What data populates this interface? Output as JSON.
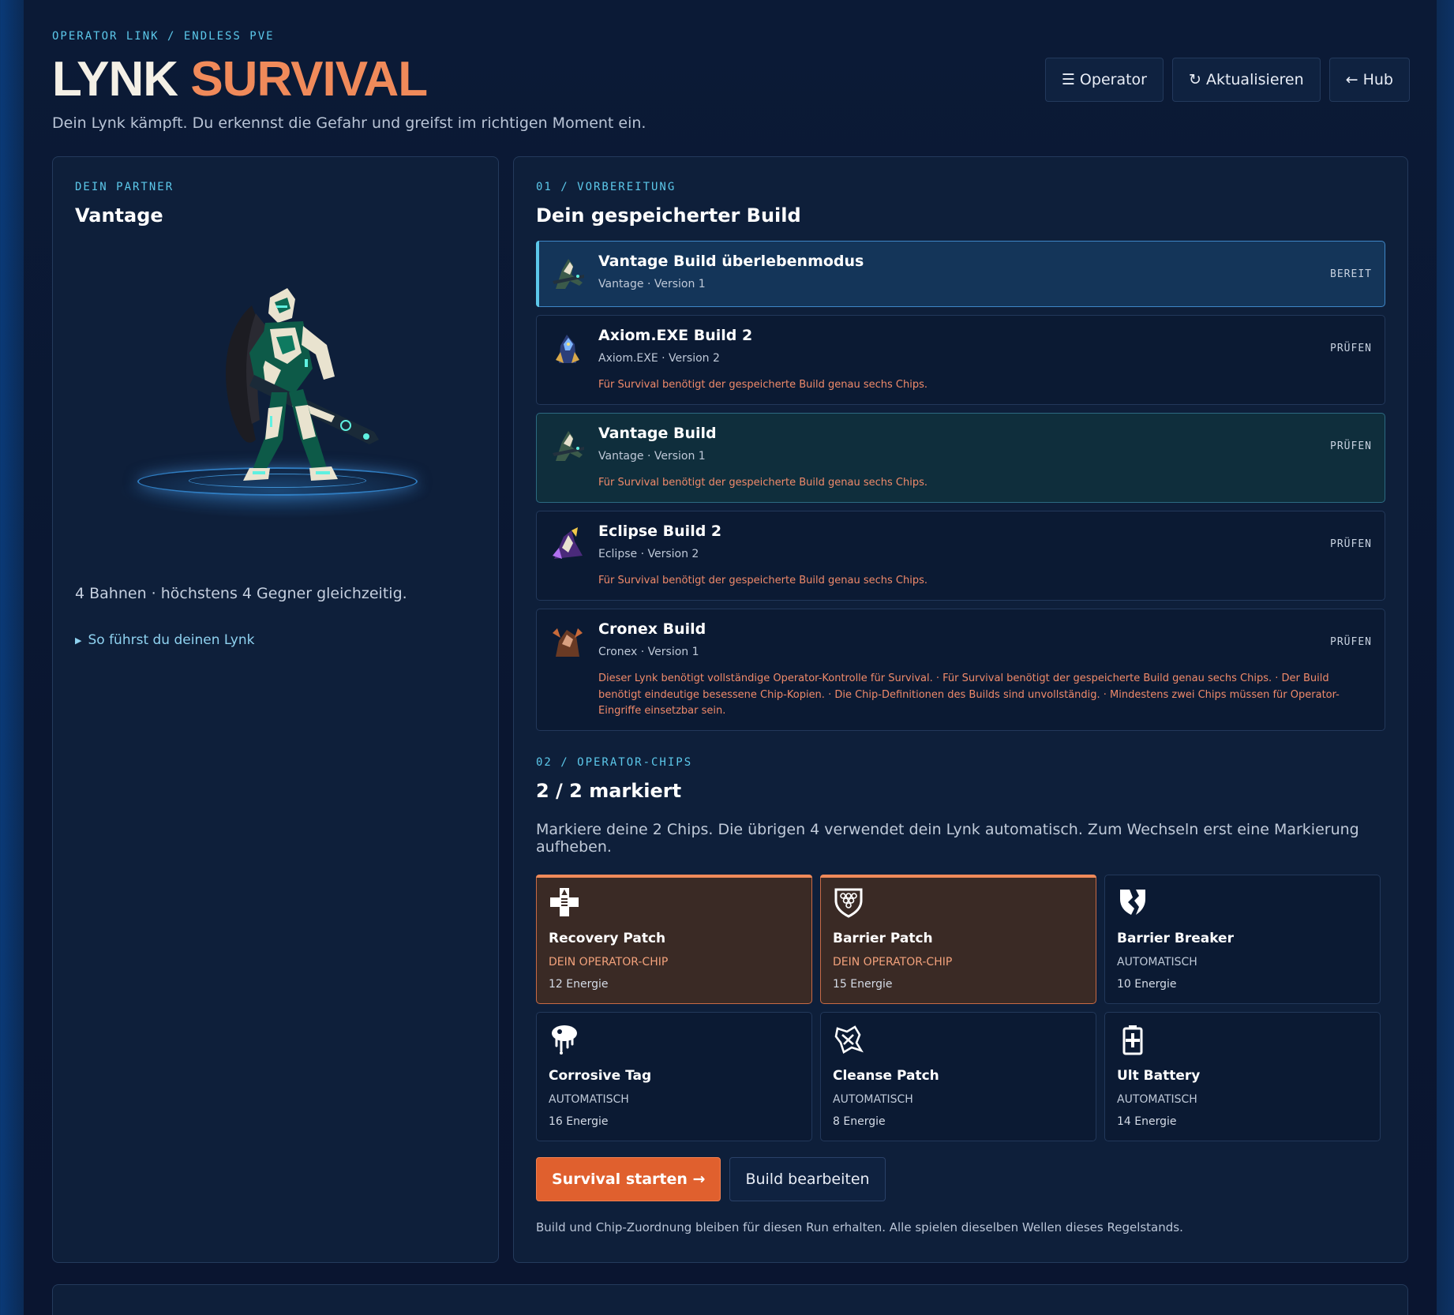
{
  "header": {
    "breadcrumb": "OPERATOR LINK / ENDLESS PVE",
    "title_a": "LYNK",
    "title_b": "SURVIVAL",
    "subtitle": "Dein Lynk kämpft. Du erkennst die Gefahr und greifst im richtigen Moment ein.",
    "buttons": {
      "operator": "☰ Operator",
      "refresh": "↻ Aktualisieren",
      "hub": "← Hub"
    }
  },
  "partner": {
    "kicker": "DEIN PARTNER",
    "name": "Vantage",
    "info": "4 Bahnen · höchstens 4 Gegner gleichzeitig.",
    "guide": "So führst du deinen Lynk"
  },
  "builds": {
    "kicker": "01 / VORBEREITUNG",
    "title": "Dein gespeicherter Build",
    "items": [
      {
        "name": "Vantage Build überlebenmodus",
        "meta": "Vantage · Version 1",
        "status": "BEREIT",
        "warning": ""
      },
      {
        "name": "Axiom.EXE Build 2",
        "meta": "Axiom.EXE · Version 2",
        "status": "PRÜFEN",
        "warning": "Für Survival benötigt der gespeicherte Build genau sechs Chips."
      },
      {
        "name": "Vantage Build",
        "meta": "Vantage · Version 1",
        "status": "PRÜFEN",
        "warning": "Für Survival benötigt der gespeicherte Build genau sechs Chips."
      },
      {
        "name": "Eclipse Build 2",
        "meta": "Eclipse · Version 2",
        "status": "PRÜFEN",
        "warning": "Für Survival benötigt der gespeicherte Build genau sechs Chips."
      },
      {
        "name": "Cronex Build",
        "meta": "Cronex · Version 1",
        "status": "PRÜFEN",
        "warning": "Dieser Lynk benötigt vollständige Operator-Kontrolle für Survival. · Für Survival benötigt der gespeicherte Build genau sechs Chips. · Der Build benötigt eindeutige besessene Chip-Kopien. · Die Chip-Definitionen des Builds sind unvollständig. · Mindestens zwei Chips müssen für Operator-Eingriffe einsetzbar sein."
      }
    ]
  },
  "chips": {
    "kicker": "02 / OPERATOR-CHIPS",
    "title": "2 / 2 markiert",
    "description": "Markiere deine 2 Chips. Die übrigen 4 verwendet dein Lynk automatisch. Zum Wechseln erst eine Markierung aufheben.",
    "items": [
      {
        "name": "Recovery Patch",
        "role": "DEIN OPERATOR-CHIP",
        "cost": "12 Energie",
        "icon": "medical-cross-icon"
      },
      {
        "name": "Barrier Patch",
        "role": "DEIN OPERATOR-CHIP",
        "cost": "15 Energie",
        "icon": "shield-icon"
      },
      {
        "name": "Barrier Breaker",
        "role": "AUTOMATISCH",
        "cost": "10 Energie",
        "icon": "broken-shield-icon"
      },
      {
        "name": "Corrosive Tag",
        "role": "AUTOMATISCH",
        "cost": "16 Energie",
        "icon": "acid-drip-icon"
      },
      {
        "name": "Cleanse Patch",
        "role": "AUTOMATISCH",
        "cost": "8 Energie",
        "icon": "cleanse-icon"
      },
      {
        "name": "Ult Battery",
        "role": "AUTOMATISCH",
        "cost": "14 Energie",
        "icon": "battery-icon"
      }
    ]
  },
  "actions": {
    "start": "Survival starten →",
    "edit": "Build bearbeiten",
    "footnote": "Build und Chip-Zuordnung bleiben für diesen Run erhalten. Alle spielen dieselben Wellen dieses Regelstands."
  },
  "colors": {
    "accent_cyan": "#5cc8ea",
    "accent_orange": "#f08a5a",
    "warning": "#f08a6a",
    "primary_button": "#e0602e"
  }
}
